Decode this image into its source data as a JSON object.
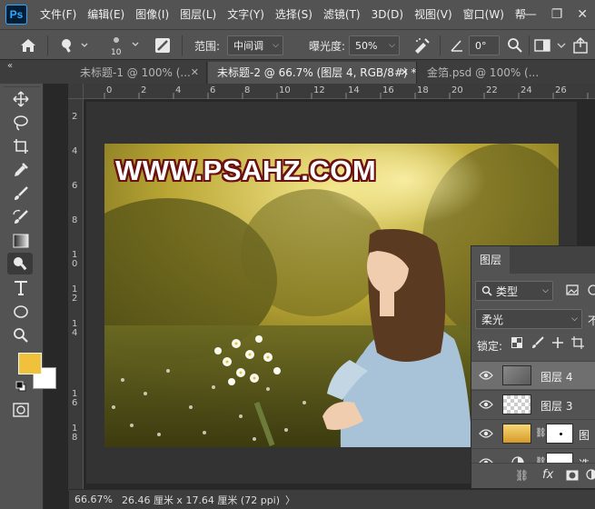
{
  "app": {
    "logo": "Ps"
  },
  "menu": [
    "文件(F)",
    "编辑(E)",
    "图像(I)",
    "图层(L)",
    "文字(Y)",
    "选择(S)",
    "滤镜(T)",
    "3D(D)",
    "视图(V)",
    "窗口(W)",
    "帮"
  ],
  "window_controls": {
    "minimize": "—",
    "restore": "❐",
    "close": "✕"
  },
  "options": {
    "brush_size": "10",
    "range_label": "范围:",
    "range_value": "中间调",
    "exposure_label": "曝光度:",
    "exposure_value": "50%",
    "angle_value": "0°"
  },
  "tabs": [
    {
      "label": "未标题-1 @ 100% (...",
      "close": "✕",
      "active": false
    },
    {
      "label": "未标题-2 @ 66.7% (图层 4, RGB/8#) *",
      "close": "✕",
      "active": true
    },
    {
      "label": "金箔.psd @ 100% (...",
      "close": "",
      "active": false
    }
  ],
  "rulers": {
    "horizontal": [
      "0",
      "2",
      "4",
      "6",
      "8",
      "10",
      "12",
      "14",
      "16",
      "18",
      "20",
      "22",
      "24",
      "26"
    ],
    "vertical": [
      "2",
      "4",
      "6",
      "8",
      "1\n0",
      "1\n2",
      "1\n4",
      "1\n6",
      "1\n8"
    ]
  },
  "canvas": {
    "watermark": "WWW.PSAHZ.COM"
  },
  "colors": {
    "foreground": "#f0c23c",
    "background": "#ffffff",
    "ui_dark": "#535353",
    "workspace": "#282828"
  },
  "status": {
    "zoom": "66.67%",
    "doc_info": "26.46 厘米 x 17.64 厘米 (72 ppi)",
    "arrow": "〉"
  },
  "layers_panel": {
    "title": "图层",
    "filter_value": "类型",
    "blend_mode": "柔光",
    "opacity_label": "不",
    "lock_label": "锁定:",
    "layers": [
      {
        "name": "图层 4",
        "selected": true,
        "thumb": "photo"
      },
      {
        "name": "图层 3",
        "selected": false,
        "thumb": "checker"
      },
      {
        "name": "图",
        "selected": false,
        "thumb": "gold"
      },
      {
        "name": "选",
        "selected": false,
        "thumb": "adjust"
      }
    ],
    "footer": {
      "fx": "fx"
    }
  }
}
